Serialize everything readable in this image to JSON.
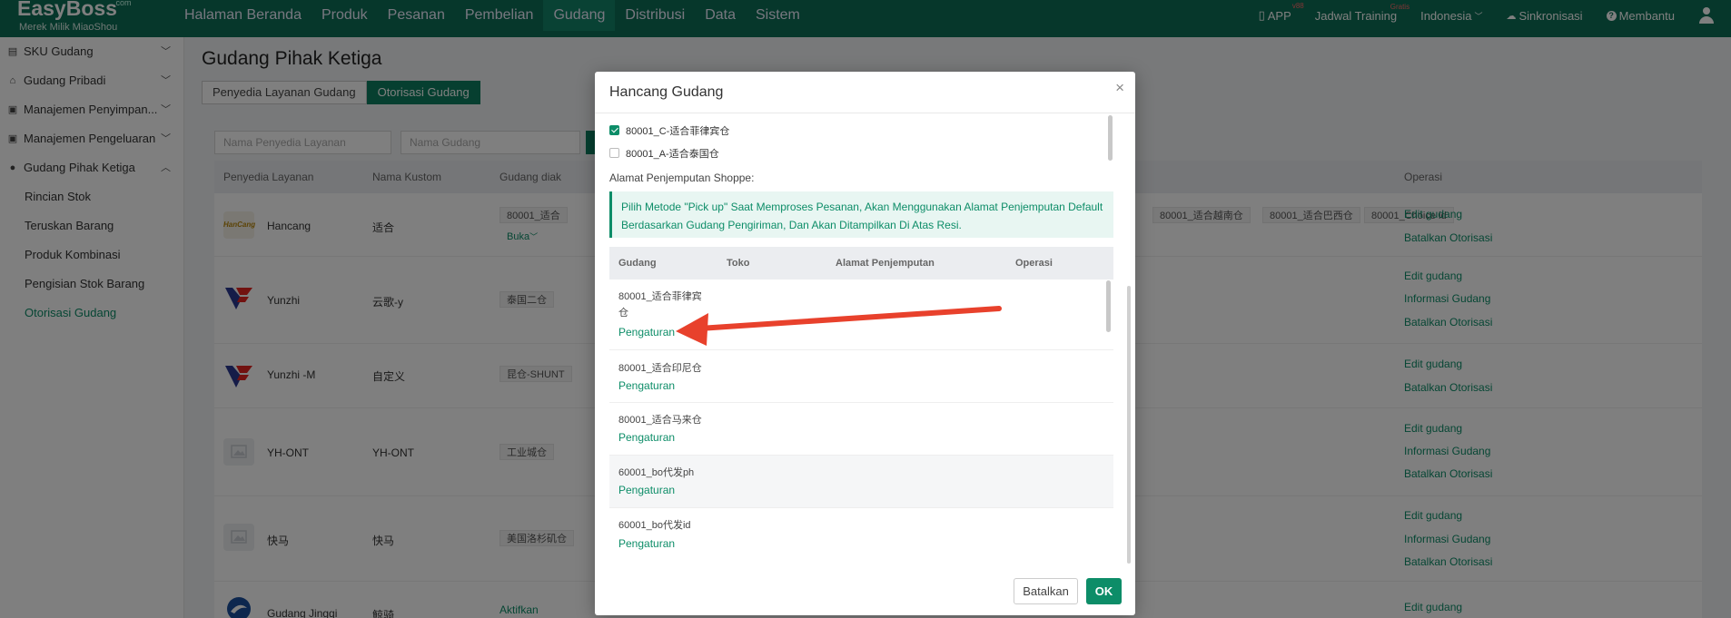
{
  "app": {
    "brand": "EasyBoss",
    "brand_sup": ".com",
    "brand_sub": "Merek Milik MiaoShou"
  },
  "nav": {
    "items": [
      "Halaman Beranda",
      "Produk",
      "Pesanan",
      "Pembelian",
      "Gudang",
      "Distribusi",
      "Data",
      "Sistem"
    ],
    "active_index": 4
  },
  "tools": {
    "app": "APP",
    "app_badge": "v88",
    "training": "Jadwal Training",
    "training_badge": "Gratis",
    "language": "Indonesia",
    "sync": "Sinkronisasi",
    "help": "Membantu"
  },
  "sidebar": {
    "groups": [
      {
        "label": "SKU Gudang",
        "icon": "document-icon"
      },
      {
        "label": "Gudang Pribadi",
        "icon": "house-icon"
      },
      {
        "label": "Manajemen Penyimpan...",
        "icon": "box-icon"
      },
      {
        "label": "Manajemen Pengeluaran",
        "icon": "box-icon"
      },
      {
        "label": "Gudang Pihak Ketiga",
        "icon": "globe-icon"
      }
    ],
    "subitems": [
      "Rincian Stok",
      "Teruskan Barang",
      "Produk Kombinasi",
      "Pengisian Stok Barang",
      "Otorisasi Gudang"
    ],
    "active_sub": 4
  },
  "page": {
    "title": "Gudang Pihak Ketiga",
    "tabs": [
      "Penyedia Layanan Gudang",
      "Otorisasi Gudang"
    ],
    "filter_provider_placeholder": "Nama Penyedia Layanan",
    "filter_warehouse_placeholder": "Nama Gudang"
  },
  "table": {
    "headers": {
      "provider": "Penyedia Layanan",
      "custom_name": "Nama Kustom",
      "warehouse": "Gudang diak",
      "operation": "Operasi"
    },
    "rows": [
      {
        "provider": "Hancang",
        "custom_name": "适合",
        "tags": [
          "80001_适合"
        ],
        "extra_tags": [
          "80001_适合越南仓",
          "80001_适合巴西仓",
          "80001_Choice id"
        ],
        "toggle": "Buka",
        "ops": [
          "Edit gudang",
          "Batalkan Otorisasi"
        ]
      },
      {
        "provider": "Yunzhi",
        "custom_name": "云歌-y",
        "tags": [
          "泰国二仓"
        ],
        "ops": [
          "Edit gudang",
          "Informasi Gudang",
          "Batalkan Otorisasi"
        ]
      },
      {
        "provider": "Yunzhi -M",
        "custom_name": "自定义",
        "tags": [
          "昆仓-SHUNT"
        ],
        "ops": [
          "Edit gudang",
          "Batalkan Otorisasi"
        ]
      },
      {
        "provider": "YH-ONT",
        "custom_name": "YH-ONT",
        "tags": [
          "工业城仓"
        ],
        "ops": [
          "Edit gudang",
          "Informasi Gudang",
          "Batalkan Otorisasi"
        ]
      },
      {
        "provider": "快马",
        "custom_name": "快马",
        "tags": [
          "美国洛杉矶仓"
        ],
        "ops": [
          "Edit gudang",
          "Informasi Gudang",
          "Batalkan Otorisasi"
        ]
      },
      {
        "provider": "Gudang Jingqi",
        "custom_name": "鲸骑",
        "status": "Aktifkan",
        "ops": [
          "Edit gudang"
        ]
      }
    ]
  },
  "modal": {
    "title": "Hancang Gudang",
    "checklist": [
      {
        "label": "80001_C-适合菲律宾仓",
        "checked": true
      },
      {
        "label": "80001_A-适合泰国仓",
        "checked": false
      }
    ],
    "address_label": "Alamat Penjemputan Shoppe:",
    "notice": "Pilih Metode \"Pick up\" Saat Memproses Pesanan, Akan Menggunakan Alamat Penjemputan Default Berdasarkan Gudang Pengiriman, Dan Akan Ditampilkan Di Atas Resi.",
    "inner_headers": {
      "warehouse": "Gudang",
      "shop": "Toko",
      "address": "Alamat Penjemputan",
      "operation": "Operasi"
    },
    "inner_rows": [
      {
        "name": "80001_适合菲律宾仓",
        "link": "Pengaturan"
      },
      {
        "name": "80001_适合印尼仓",
        "link": "Pengaturan"
      },
      {
        "name": "80001_适合马来仓",
        "link": "Pengaturan"
      },
      {
        "name": "60001_bo代发ph",
        "link": "Pengaturan"
      },
      {
        "name": "60001_bo代发id",
        "link": "Pengaturan"
      }
    ],
    "cancel": "Batalkan",
    "ok": "OK"
  },
  "colors": {
    "brand": "#0d6e56",
    "accent": "#0d8d68",
    "annotation_arrow": "#e8412c"
  }
}
